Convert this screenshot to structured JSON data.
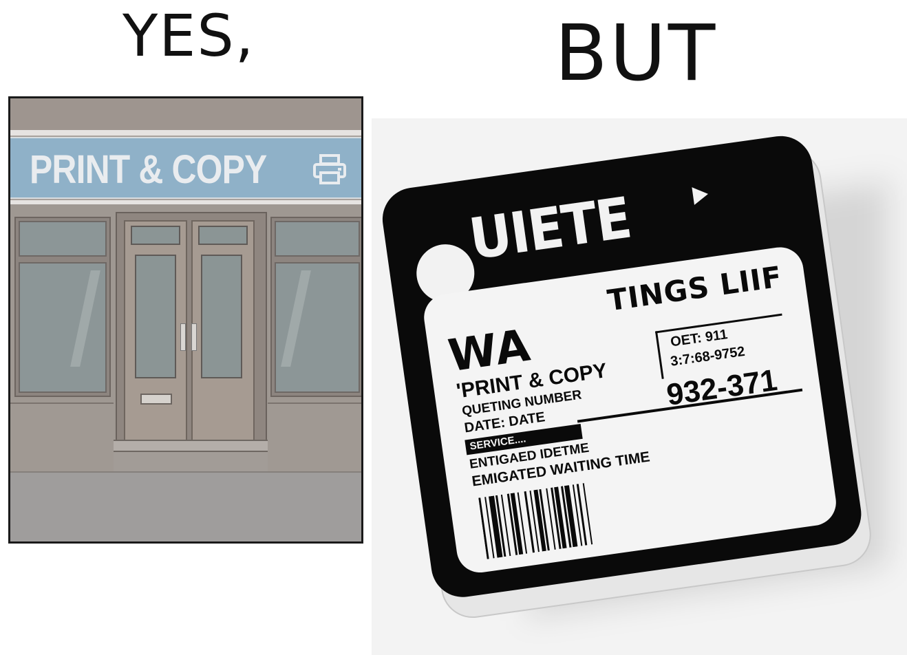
{
  "captions": {
    "left": "YES,",
    "right": "BUT"
  },
  "shop": {
    "sign_text": "PRINT & COPY",
    "sign_icon": "printer-icon",
    "colors": {
      "sign_board": "#8fb1c8",
      "facade": "#a8a19c"
    }
  },
  "ticket": {
    "logo_text": "UIETE",
    "heading_right": "TINGS LIIF",
    "heading_main": "WA",
    "shop_line": "'PRINT & COPY",
    "queue_label": "QUETING NUMBER",
    "date_line": "DATE:     DATE",
    "service_label": "SERVICE....",
    "est_line_1": "ENTIGAED IDETME",
    "est_line_2": "EMIGATED WAITING TIME",
    "code_line_1": "OET: 911",
    "code_line_2": "3:7:68-9752",
    "number": "932-371",
    "colors": {
      "body": "#0a0a0a",
      "label": "#f4f4f4"
    }
  }
}
